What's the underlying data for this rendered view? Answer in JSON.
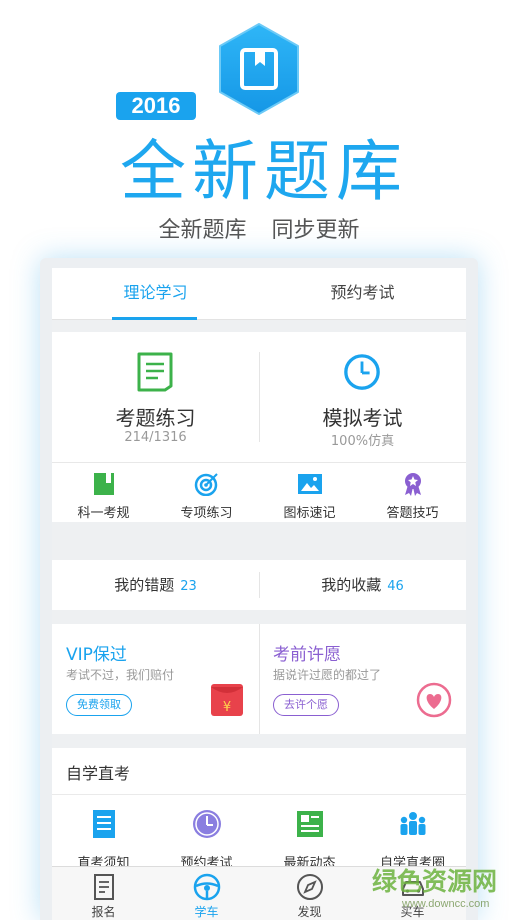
{
  "hero": {
    "year": "2016",
    "title": "全新题库",
    "subtitle": "全新题库  同步更新"
  },
  "tabs": [
    {
      "label": "理论学习",
      "active": true
    },
    {
      "label": "预约考试",
      "active": false
    }
  ],
  "main": {
    "practice": {
      "title": "考题练习",
      "sub": "214/1316",
      "icon": "document-icon"
    },
    "mock": {
      "title": "模拟考试",
      "sub": "100%仿真",
      "icon": "clock-icon"
    },
    "shortcuts": [
      {
        "label": "科一考规",
        "icon": "book-icon"
      },
      {
        "label": "专项练习",
        "icon": "target-icon"
      },
      {
        "label": "图标速记",
        "icon": "image-icon"
      },
      {
        "label": "答题技巧",
        "icon": "medal-icon"
      }
    ]
  },
  "records": {
    "wrong": {
      "label": "我的错题",
      "count": "23"
    },
    "favorites": {
      "label": "我的收藏",
      "count": "46"
    }
  },
  "promos": {
    "vip": {
      "title": "VIP保过",
      "desc": "考试不过，我们赔付",
      "button": "免费领取",
      "color": "#1aa3ee",
      "icon": "red-envelope-icon"
    },
    "wish": {
      "title": "考前许愿",
      "desc": "据说许过愿的都过了",
      "button": "去许个愿",
      "color": "#8a5fd1",
      "icon": "heart-icon"
    }
  },
  "self_study": {
    "title": "自学直考",
    "items": [
      {
        "label": "直考须知",
        "icon": "notice-icon"
      },
      {
        "label": "预约考试",
        "icon": "clock-icon"
      },
      {
        "label": "最新动态",
        "icon": "news-icon"
      },
      {
        "label": "自学直考圈",
        "icon": "group-icon"
      }
    ]
  },
  "bottom_nav": [
    {
      "label": "报名",
      "icon": "register-icon",
      "active": false
    },
    {
      "label": "学车",
      "icon": "steering-wheel-icon",
      "active": true
    },
    {
      "label": "发现",
      "icon": "compass-icon",
      "active": false
    },
    {
      "label": "买车",
      "icon": "car-icon",
      "active": false
    }
  ],
  "watermark": {
    "text": "绿色资源网",
    "url": "www.downcc.com"
  },
  "colors": {
    "accent": "#1aa3ee",
    "green": "#3cb24a",
    "purple": "#8a5fd1",
    "red": "#e8424b",
    "pink": "#ec6c90"
  }
}
